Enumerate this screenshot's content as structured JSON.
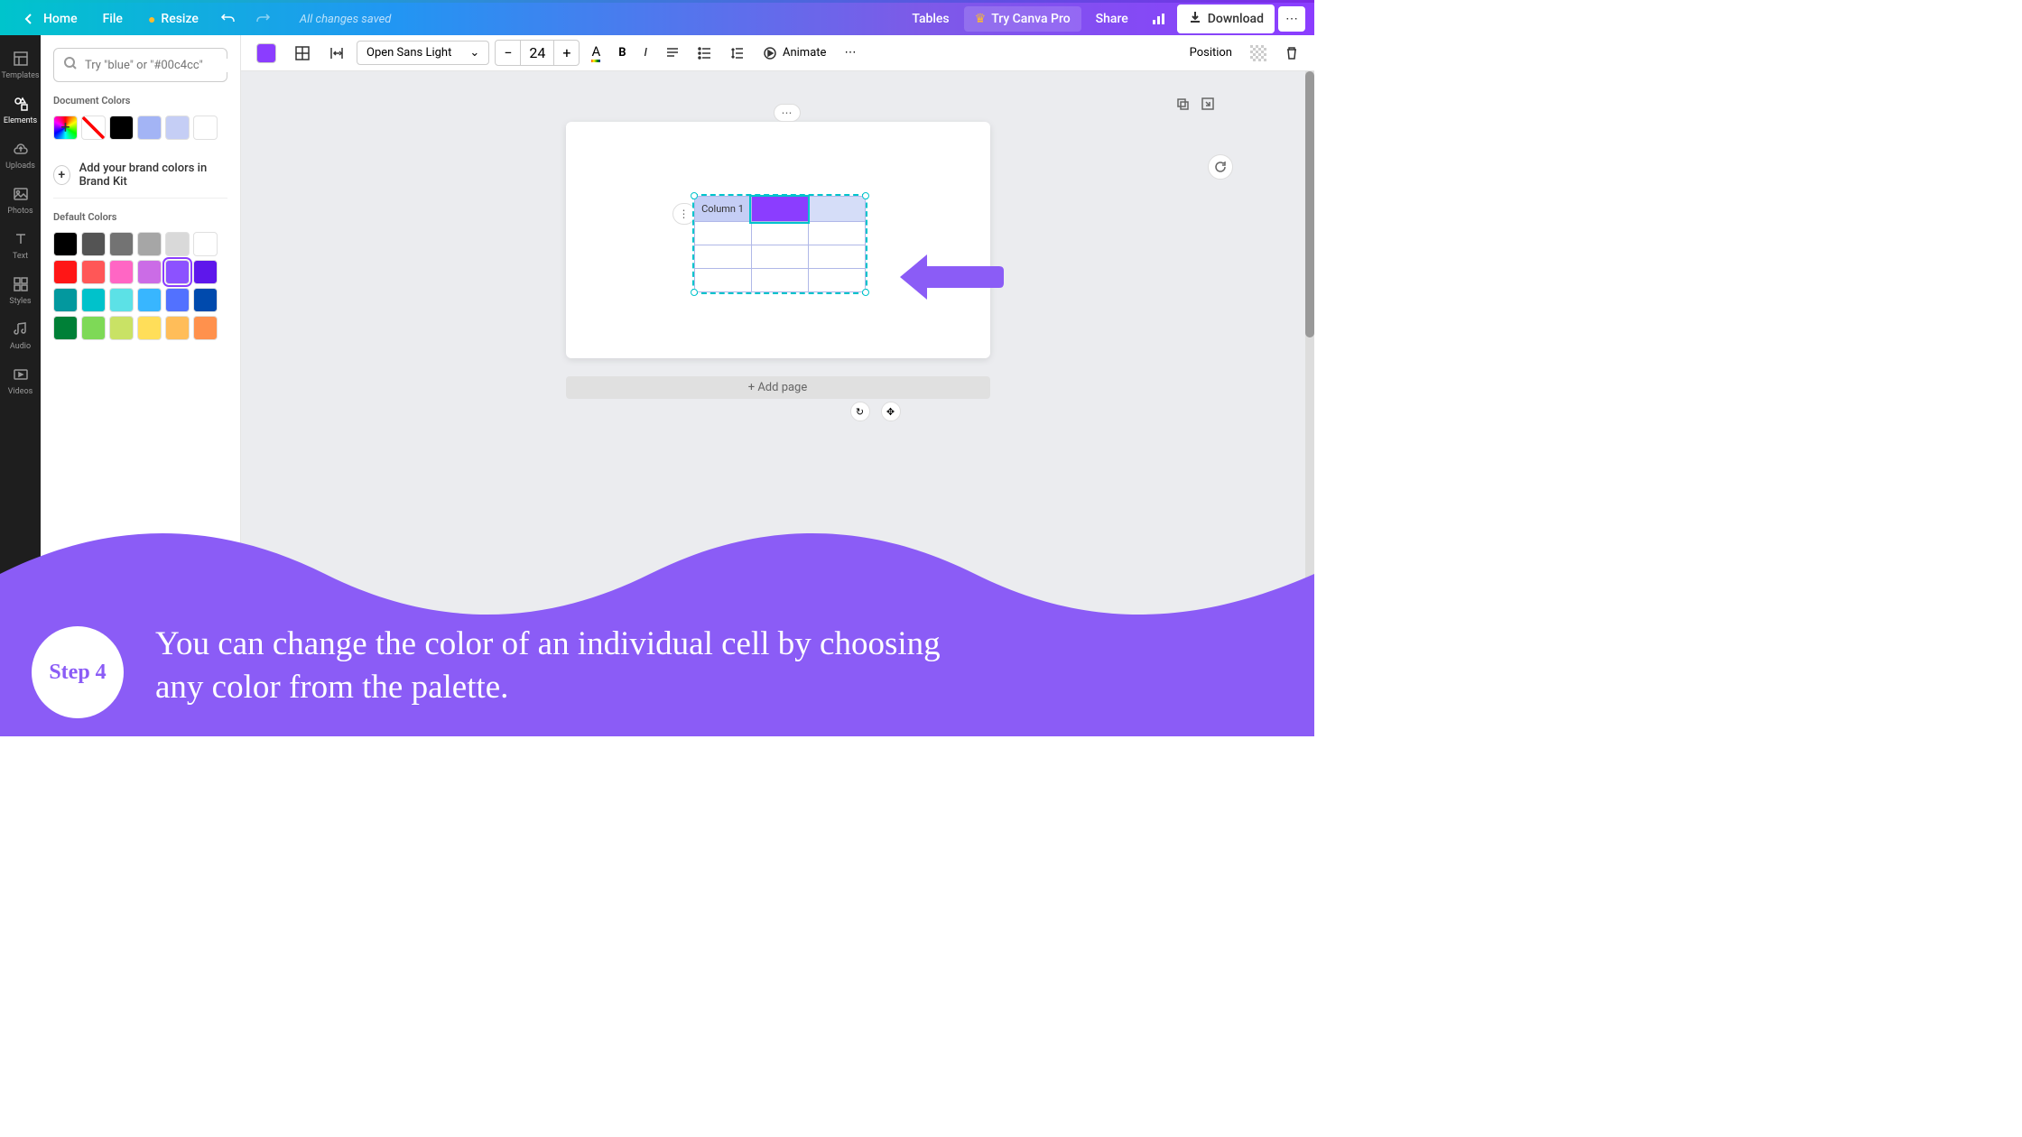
{
  "header": {
    "home": "Home",
    "file": "File",
    "resize": "Resize",
    "saved": "All changes saved",
    "tables": "Tables",
    "try_pro": "Try Canva Pro",
    "share": "Share",
    "download": "Download"
  },
  "sidebar": {
    "items": [
      {
        "label": "Templates"
      },
      {
        "label": "Elements"
      },
      {
        "label": "Uploads"
      },
      {
        "label": "Photos"
      },
      {
        "label": "Text"
      },
      {
        "label": "Styles"
      },
      {
        "label": "Audio"
      },
      {
        "label": "Videos"
      }
    ]
  },
  "panel": {
    "search_placeholder": "Try \"blue\" or \"#00c4cc\"",
    "doc_colors_title": "Document Colors",
    "brand_kit": "Add your brand colors in Brand Kit",
    "default_colors_title": "Default Colors",
    "doc_colors": [
      "#000000",
      "#a3b4f5",
      "#c5cef5",
      "#ffffff"
    ],
    "default_colors": [
      "#000000",
      "#545454",
      "#737373",
      "#a6a6a6",
      "#d9d9d9",
      "#ffffff",
      "#ff1616",
      "#ff5757",
      "#ff66c4",
      "#cb6ce6",
      "#8c52ff",
      "#5e17eb",
      "#03989e",
      "#00c2cb",
      "#5ce1e6",
      "#38b6ff",
      "#5271ff",
      "#004aad",
      "#008037",
      "#7ed957",
      "#c9e265",
      "#ffde59",
      "#ffbd59",
      "#ff914d"
    ],
    "selected_color": "#8c52ff"
  },
  "toolbar": {
    "font": "Open Sans Light",
    "size": "24",
    "animate": "Animate",
    "position": "Position"
  },
  "canvas": {
    "column1": "Column 1",
    "add_page": "+ Add page"
  },
  "tutorial": {
    "step": "Step 4",
    "text": "You can change the color of an individual cell by choosing any color from the palette."
  }
}
